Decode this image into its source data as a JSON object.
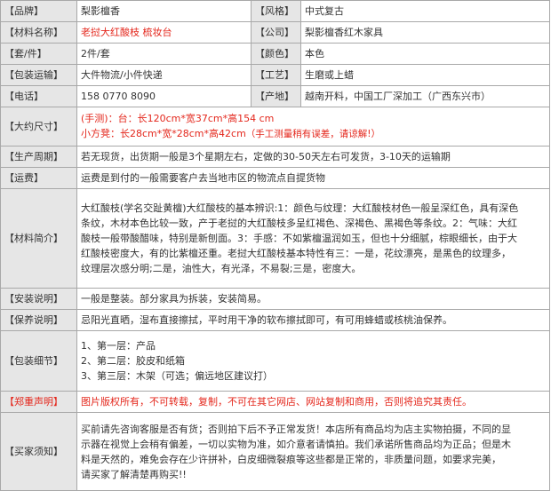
{
  "rows": {
    "brand": {
      "label": "【品牌】",
      "value": "梨影檀香"
    },
    "style": {
      "label": "【风格】",
      "value": "中式复古"
    },
    "material": {
      "label": "【材料名称】",
      "value": "老挝大红酸枝 梳妆台"
    },
    "company": {
      "label": "【公司】",
      "value": "梨影檀香红木家具"
    },
    "set": {
      "label": "【套/件】",
      "value": "2件/套"
    },
    "color": {
      "label": "【颜色】",
      "value": "本色"
    },
    "shipping": {
      "label": "【包装运输】",
      "value": "大件物流/小件快递"
    },
    "craft": {
      "label": "【工艺】",
      "value": "生磨或上蜡"
    },
    "phone": {
      "label": "【电话】",
      "value": "158 0770 8090"
    },
    "origin": {
      "label": "【产地】",
      "value": "越南开料，中国工厂深加工（广西东兴市）"
    },
    "size": {
      "label": "【大约尺寸】",
      "line1": "(手测)：台：长120cm*宽37cm*高154 cm",
      "line2_main": "小方凳：长28cm*宽*28cm*高42cm",
      "line2_note": "（手工测量稍有误差，请谅解!）"
    },
    "cycle": {
      "label": "【生产周期】",
      "value": "若无现货，出货期一般是3个星期左右，定做的30-50天左右可发货，3-10天的运输期"
    },
    "freight": {
      "label": "【运费】",
      "value": "运费是到付的一般需要客户去当地市区的物流点自提货物"
    },
    "intro": {
      "label": "【材料简介】",
      "lines": [
        "大红酸枝(学名交趾黄檀)大红酸枝的基本辨识:1：颜色与纹理：大红酸枝材色一般呈深红色，具有深色",
        "条纹，木材本色比较一致，产于老挝的大红酸枝多呈红褐色、深褐色、黑褐色等条纹。2：气味：大红",
        "酸枝一般带酸醋味，特别是新刨面。3：手感：不如紫檀温润如玉，但也十分细腻，棕眼细长，由于大",
        "红酸枝密度大，有的比紫檀还重。老挝大红酸枝基本特性有三：一是，花纹漂亮，是黑色的纹理多，",
        "纹理层次感分明;二是，油性大，有光泽，不易裂;三是，密度大。"
      ]
    },
    "install": {
      "label": "【安装说明】",
      "value": "一般是整装。部分家具为拆装，安装简易。"
    },
    "care": {
      "label": "【保养说明】",
      "value": "忌阳光直晒，湿布直接擦拭，平时用干净的软布擦拭即可，有可用蜂蜡或核桃油保养。"
    },
    "packing": {
      "label": "【包装细节】",
      "lines": [
        "1、第一层：产品",
        "2、第二层：胶皮和纸箱",
        "3、第三层：木架（可选；偏远地区建议打）"
      ]
    },
    "notice": {
      "label": "【郑重声明】",
      "value": "图片版权所有，不可转载，复制，不可在其它网店、网站复制和商用，否则将追究其责任。"
    },
    "buyer": {
      "label": "【买家须知】",
      "lines": [
        "买前请先咨询客服是否有货；否则拍下后不予正常发货！本店所有商品均为店主实物拍摄，不同的显",
        "示器在视觉上会稍有偏差，一切以实物为准，如介意者请慎拍。我们承诺所售商品均为正品；但是木",
        "料是天然的，难免会存在少许拼补，白皮细微裂痕等这些都是正常的，非质量问题，如要求完美，",
        "请买家了解清楚再购买!!"
      ]
    }
  },
  "colors": {
    "label_bg": "#e6e6e6",
    "border": "#a8a8a8",
    "accent": "#e4271c",
    "text": "#333333"
  }
}
